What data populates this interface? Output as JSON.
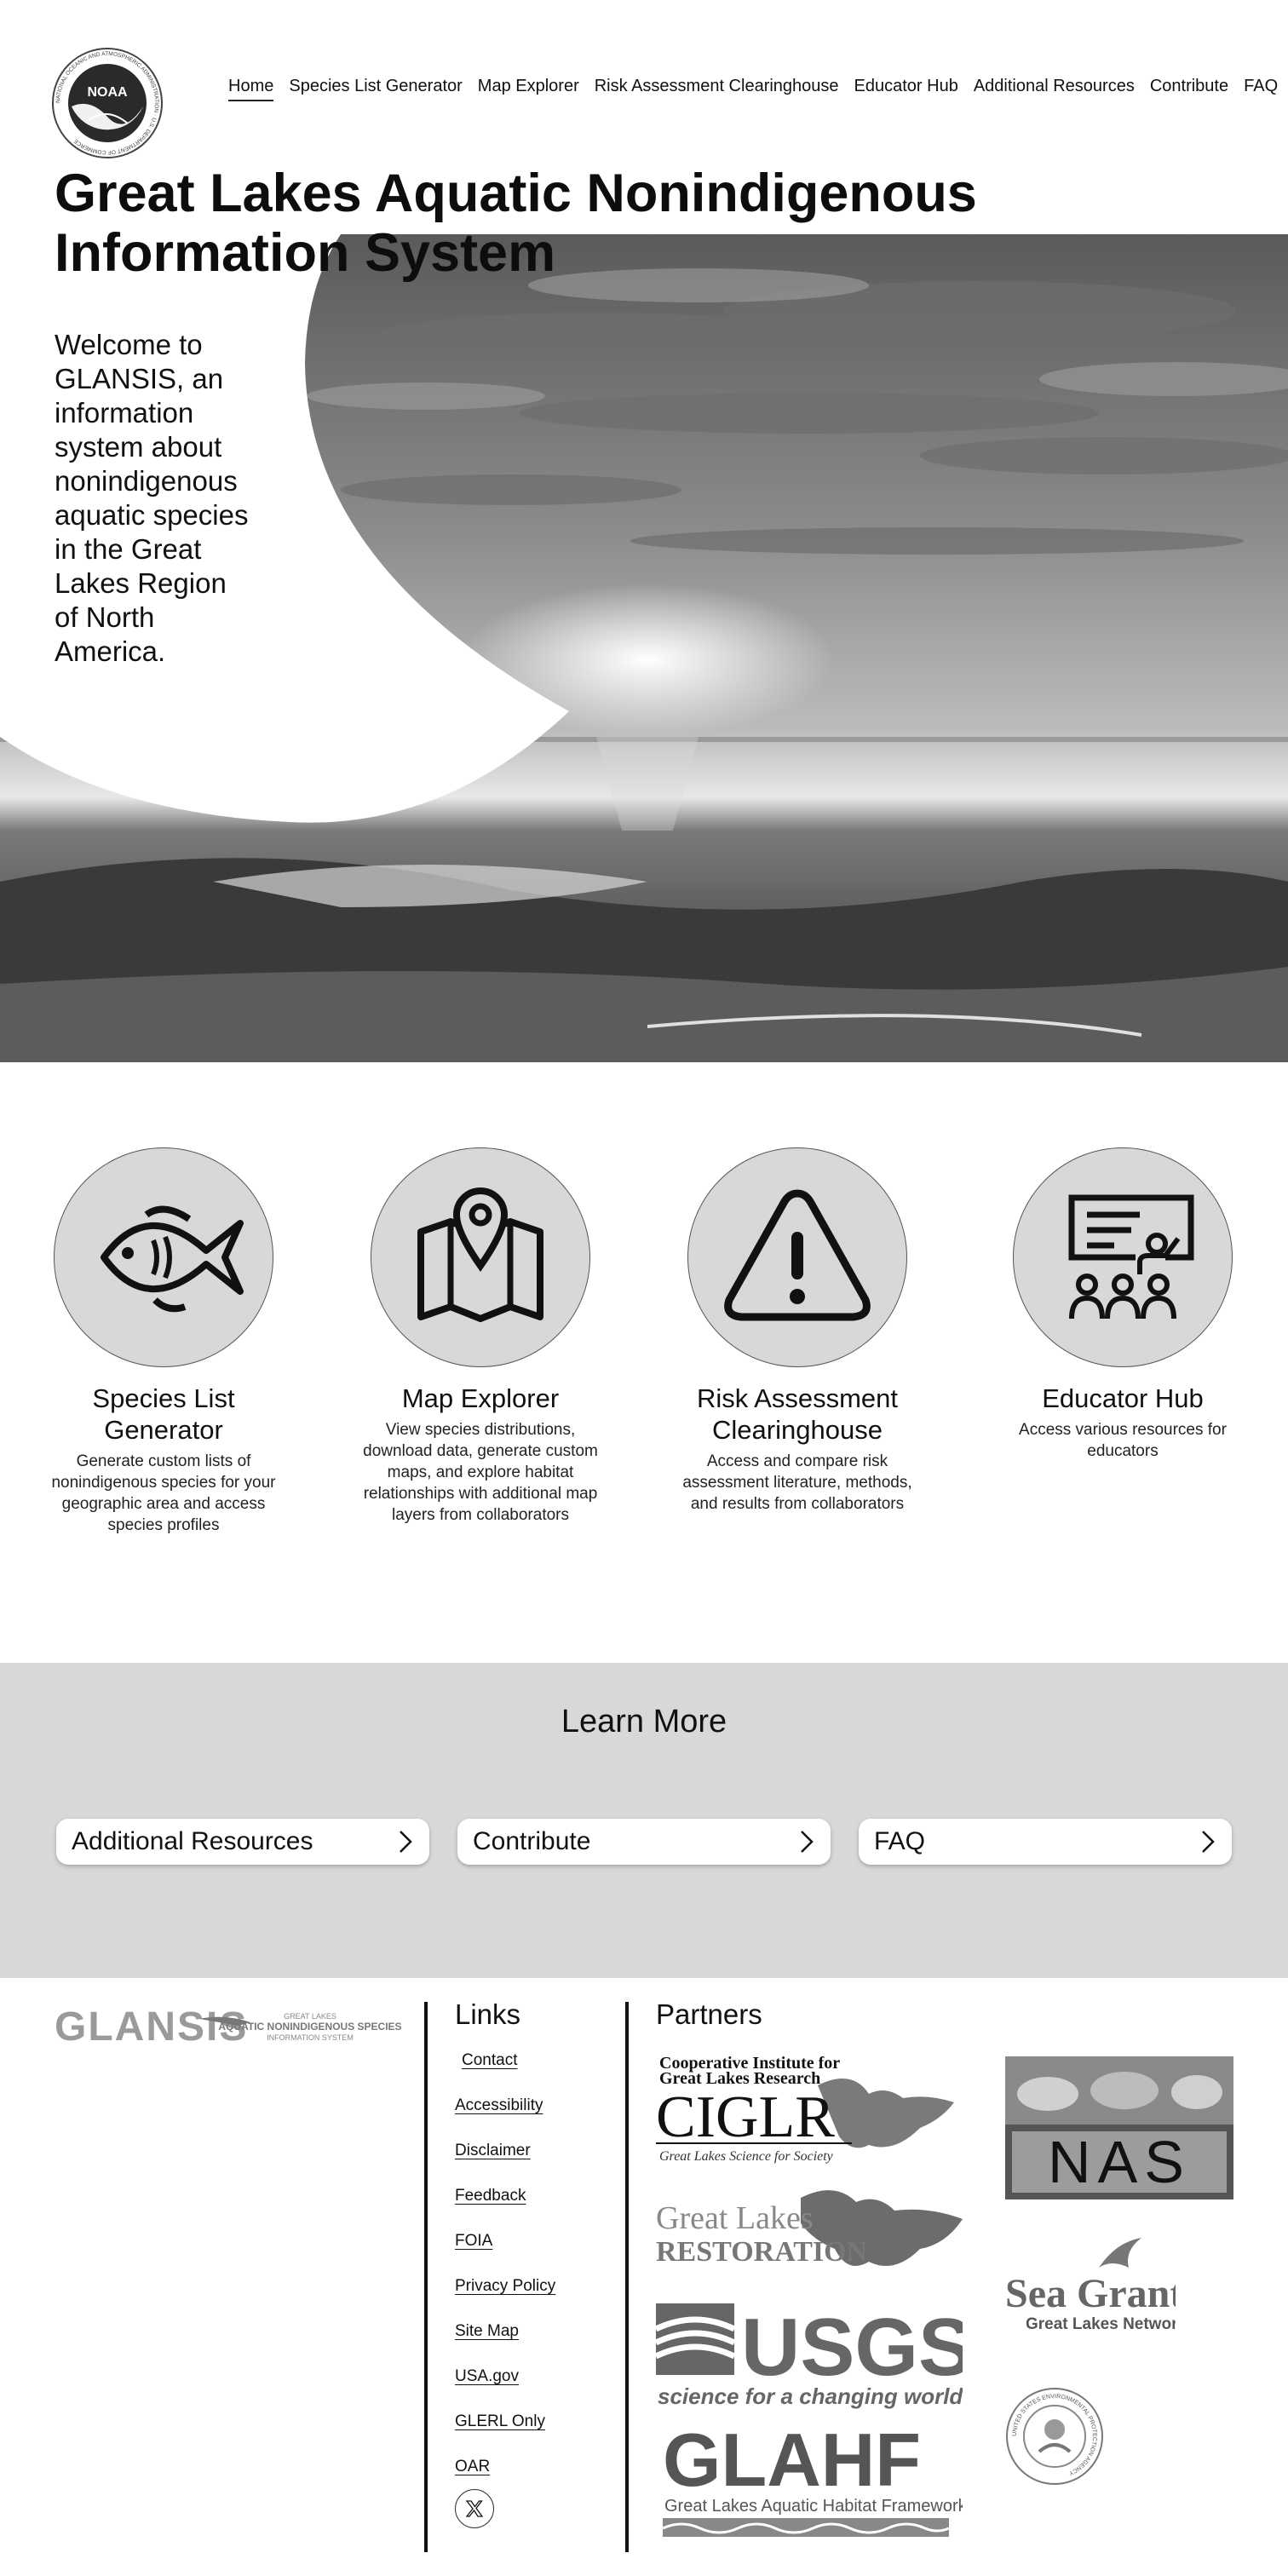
{
  "header": {
    "logo_text": "NOAA",
    "logo_ring_text": "NATIONAL OCEANIC AND ATMOSPHERIC ADMINISTRATION · U.S. DEPARTMENT OF COMMERCE",
    "nav": [
      {
        "label": "Home",
        "active": true
      },
      {
        "label": "Species List Generator"
      },
      {
        "label": "Map Explorer"
      },
      {
        "label": "Risk Assessment Clearinghouse"
      },
      {
        "label": "Educator Hub"
      },
      {
        "label": "Additional Resources"
      },
      {
        "label": "Contribute"
      },
      {
        "label": "FAQ"
      }
    ]
  },
  "title": "Great Lakes Aquatic Nonindigenous Information System",
  "hero": {
    "welcome": "Welcome to GLANSIS, an information system about nonindigenous aquatic species in the Great Lakes Region of North America."
  },
  "features": [
    {
      "icon": "fish-icon",
      "title": "Species List Generator",
      "text": "Generate custom lists of nonindigenous species for your geographic area and access species profiles"
    },
    {
      "icon": "map-icon",
      "title": "Map Explorer",
      "text": "View species distributions, download data, generate custom maps, and explore habitat relationships with additional map layers from collaborators"
    },
    {
      "icon": "warning-icon",
      "title": "Risk Assessment Clearinghouse",
      "text": "Access and compare risk assessment literature, methods, and results from collaborators"
    },
    {
      "icon": "classroom-icon",
      "title": "Educator Hub",
      "text": "Access various resources for educators"
    }
  ],
  "learn_more": {
    "heading": "Learn More",
    "buttons": [
      "Additional Resources",
      "Contribute",
      "FAQ"
    ]
  },
  "footer": {
    "logo_word": "GLANSIS",
    "logo_sub1": "GREAT LAKES",
    "logo_sub2": "AQUATIC NONINDIGENOUS SPECIES",
    "logo_sub3": "INFORMATION SYSTEM",
    "links_heading": "Links",
    "links": [
      "Contact",
      "Accessibility",
      "Disclaimer",
      "Feedback",
      "FOIA",
      "Privacy Policy",
      "Site Map",
      "USA.gov",
      "GLERL Only",
      "OAR"
    ],
    "partners_heading": "Partners",
    "partners": {
      "ciglr_top": "Cooperative Institute for",
      "ciglr_top2": "Great Lakes Research",
      "ciglr_name": "CIGLR",
      "ciglr_tag": "Great Lakes Science for Society",
      "nas": "NAS",
      "glri1": "Great Lakes",
      "glri2": "RESTORATION",
      "seagrant1": "Sea Grant",
      "seagrant2": "Great Lakes Network",
      "usgs": "USGS",
      "usgs_tag": "science for a changing world",
      "epa_ring": "UNITED STATES ENVIRONMENTAL PROTECTION AGENCY",
      "glahf": "GLAHF",
      "glahf_tag": "Great Lakes Aquatic Habitat Framework"
    }
  }
}
